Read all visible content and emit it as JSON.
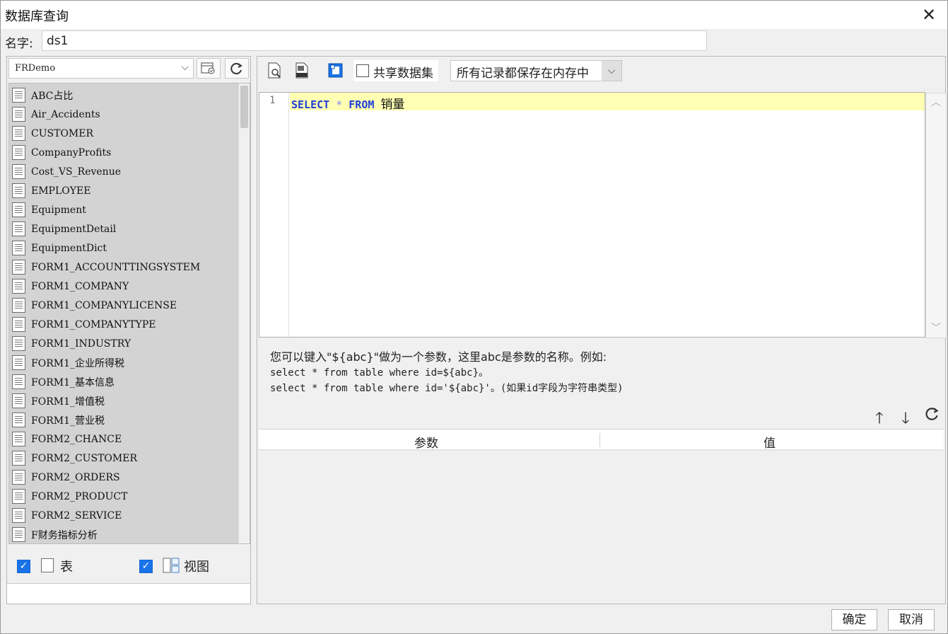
{
  "window": {
    "title": "数据库查询",
    "close_glyph": "✕"
  },
  "name_field": {
    "label": "名字:",
    "value": "ds1"
  },
  "left": {
    "database": "FRDemo",
    "tables": [
      "ABC占比",
      "Air_Accidents",
      "CUSTOMER",
      "CompanyProfits",
      "Cost_VS_Revenue",
      "EMPLOYEE",
      "Equipment",
      "EquipmentDetail",
      "EquipmentDict",
      "FORM1_ACCOUNTTINGSYSTEM",
      "FORM1_COMPANY",
      "FORM1_COMPANYLICENSE",
      "FORM1_COMPANYTYPE",
      "FORM1_INDUSTRY",
      "FORM1_企业所得税",
      "FORM1_基本信息",
      "FORM1_增值税",
      "FORM1_营业税",
      "FORM2_CHANCE",
      "FORM2_CUSTOMER",
      "FORM2_ORDERS",
      "FORM2_PRODUCT",
      "FORM2_SERVICE",
      "F财务指标分析"
    ],
    "filters": {
      "table_label": "表",
      "view_label": "视图",
      "table_checked": true,
      "view_checked": true
    }
  },
  "right": {
    "share_label": "共享数据集",
    "memory_option": "所有记录都保存在内存中",
    "editor": {
      "line_number": "1",
      "kw_select": "SELECT",
      "op_star": "*",
      "kw_from": "FROM",
      "table": "销量"
    },
    "hint": {
      "line1": "您可以键入\"${abc}\"做为一个参数，这里abc是参数的名称。例如:",
      "line2": "select * from table where id=${abc}。",
      "line3": "select * from table where id='${abc}'。(如果id字段为字符串类型)"
    },
    "param_table": {
      "col_param": "参数",
      "col_value": "值"
    }
  },
  "buttons": {
    "ok": "确定",
    "cancel": "取消"
  },
  "colors": {
    "accent": "#1a73e8",
    "keyword": "#1f3fd7",
    "line_highlight": "#ffffb4",
    "list_bg": "#d3d3d3"
  }
}
